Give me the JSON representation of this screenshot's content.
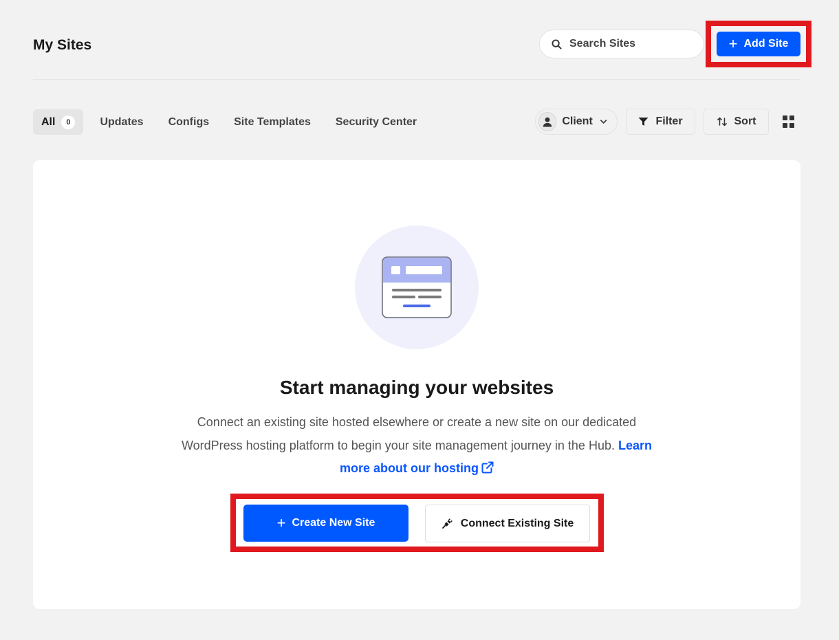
{
  "header": {
    "title": "My Sites",
    "search_placeholder": "Search Sites",
    "add_site_label": "Add Site"
  },
  "tabs": [
    {
      "label": "All",
      "count": "0",
      "active": true
    },
    {
      "label": "Updates"
    },
    {
      "label": "Configs"
    },
    {
      "label": "Site Templates"
    },
    {
      "label": "Security Center"
    }
  ],
  "controls": {
    "client_label": "Client",
    "filter_label": "Filter",
    "sort_label": "Sort"
  },
  "empty_state": {
    "title": "Start managing your websites",
    "description": "Connect an existing site hosted elsewhere or create a new site on our dedicated WordPress hosting platform to begin your site management journey in the Hub.",
    "link_text": "Learn more about our hosting",
    "create_label": "Create New Site",
    "connect_label": "Connect Existing Site"
  },
  "colors": {
    "primary": "#0059ff",
    "highlight": "#e0191e",
    "background": "#f2f2f2"
  },
  "icons": [
    "search-icon",
    "plus-icon",
    "user-icon",
    "chevron-down-icon",
    "filter-icon",
    "sort-icon",
    "grid-view-icon",
    "browser-window-icon",
    "external-link-icon",
    "plug-icon"
  ]
}
